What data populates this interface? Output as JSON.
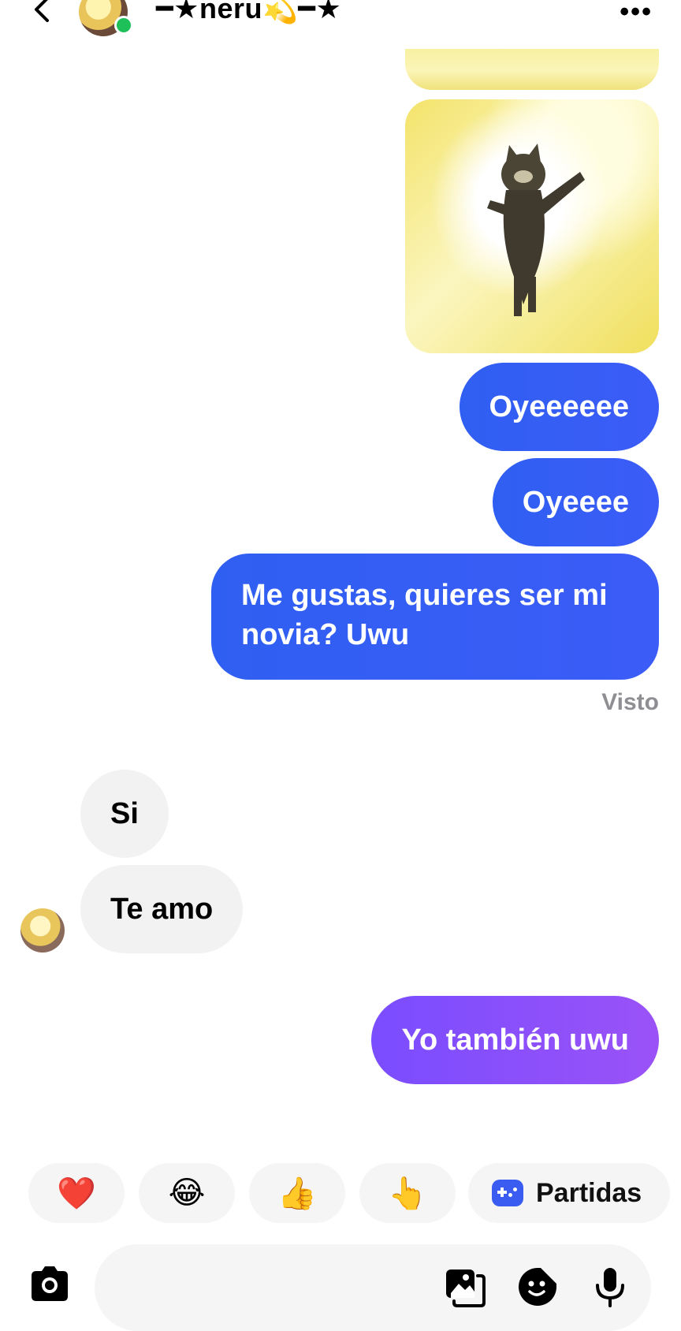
{
  "header": {
    "contact_name": "━★neru💫━★",
    "more_label": "•••"
  },
  "messages": {
    "outgoing_1": "Oyeeeeee",
    "outgoing_2": "Oyeeee",
    "outgoing_3": "Me gustas, quieres ser mi novia? Uwu",
    "seen_label": "Visto",
    "incoming_1": "Si",
    "incoming_2": "Te amo",
    "outgoing_4": "Yo también uwu"
  },
  "quick_reactions": {
    "heart": "❤️",
    "laugh": "😂",
    "thumbs_up": "👍",
    "point_up": "👆",
    "games_label": "Partidas"
  },
  "colors": {
    "outgoing_blue": "#3c5cf7",
    "outgoing_purple": "#9a52f7",
    "incoming_bg": "#f2f2f3",
    "online": "#1ec05a"
  }
}
